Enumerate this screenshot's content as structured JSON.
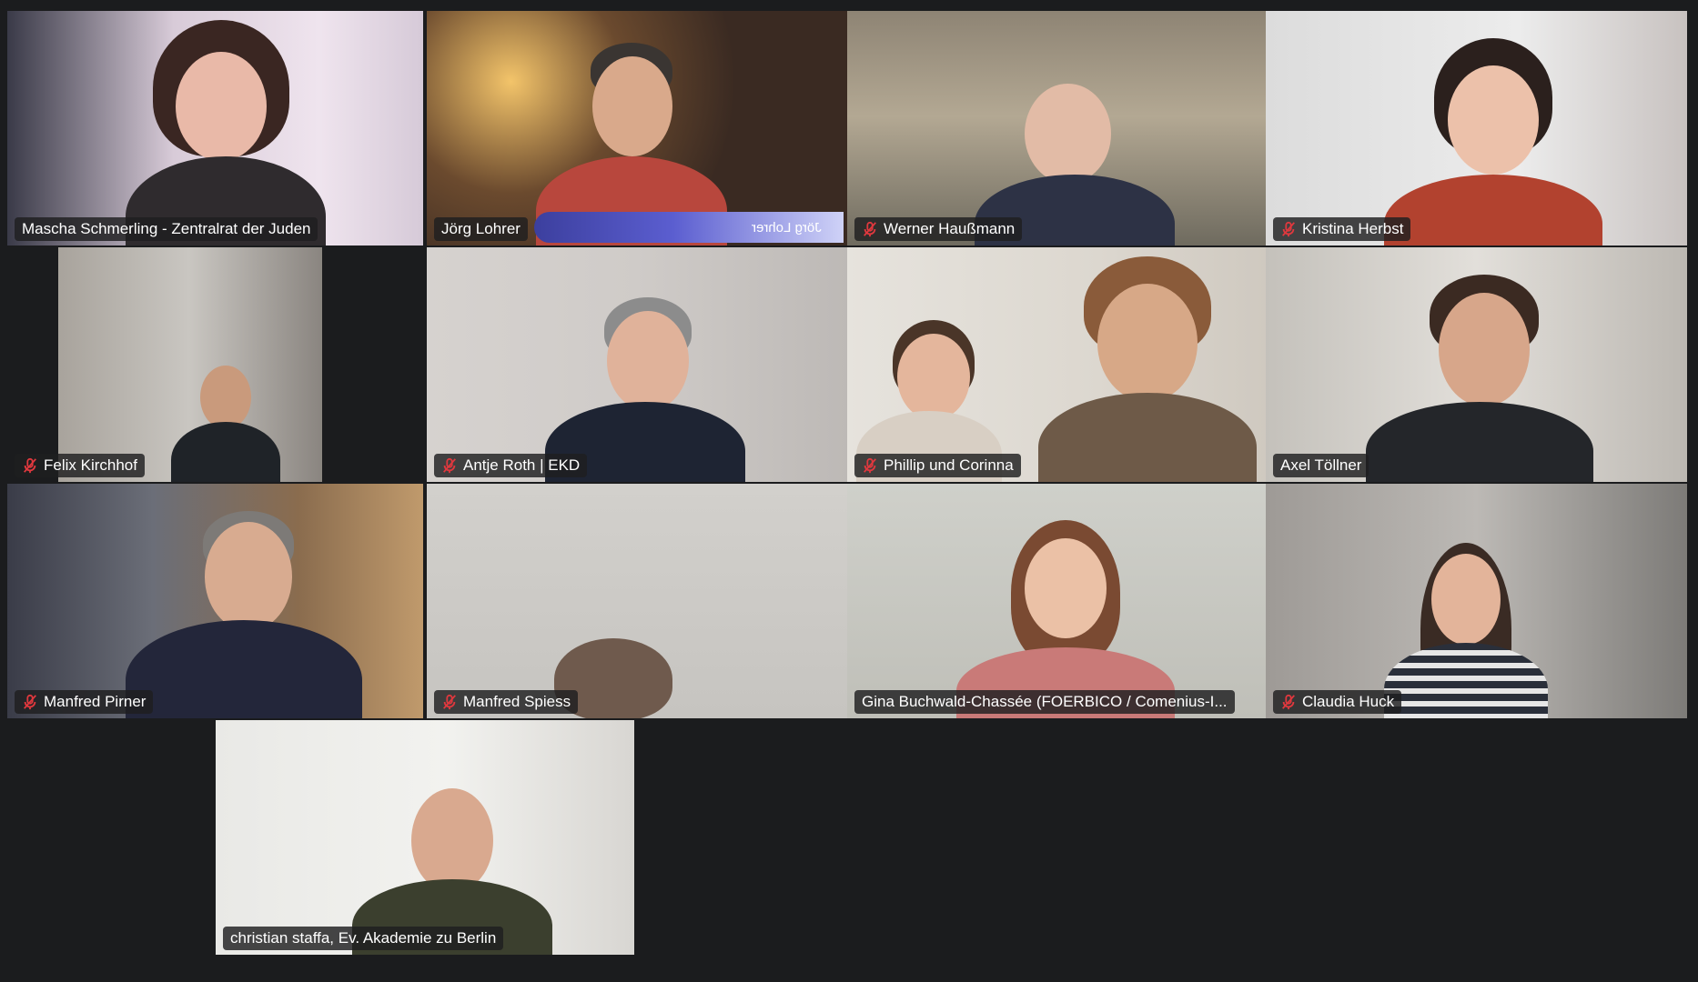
{
  "participants": [
    {
      "name": "Mascha Schmerling - Zentralrat der Juden",
      "muted": false,
      "active": false
    },
    {
      "name": "Jörg Lohrer",
      "muted": false,
      "active": true,
      "banner": "Jörg Lohrer"
    },
    {
      "name": "Werner Haußmann",
      "muted": true,
      "active": false
    },
    {
      "name": "Kristina Herbst",
      "muted": true,
      "active": false
    },
    {
      "name": "Felix Kirchhof",
      "muted": true,
      "active": false
    },
    {
      "name": "Antje Roth | EKD",
      "muted": true,
      "active": false
    },
    {
      "name": "Phillip und Corinna",
      "muted": true,
      "active": false
    },
    {
      "name": "Axel Töllner",
      "muted": false,
      "active": false
    },
    {
      "name": "Manfred Pirner",
      "muted": true,
      "active": false
    },
    {
      "name": "Manfred Spiess",
      "muted": true,
      "active": false
    },
    {
      "name": "Gina Buchwald-Chassée (FOERBICO / Comenius-I...",
      "muted": false,
      "active": false
    },
    {
      "name": "Claudia Huck",
      "muted": true,
      "active": false
    },
    {
      "name": "christian staffa, Ev. Akademie zu Berlin",
      "muted": false,
      "active": false
    }
  ],
  "colors": {
    "background": "#1b1c1e",
    "active_speaker": "#2ecc54",
    "muted_icon": "#e0383e"
  },
  "icons": {
    "muted": "microphone-muted-icon"
  }
}
